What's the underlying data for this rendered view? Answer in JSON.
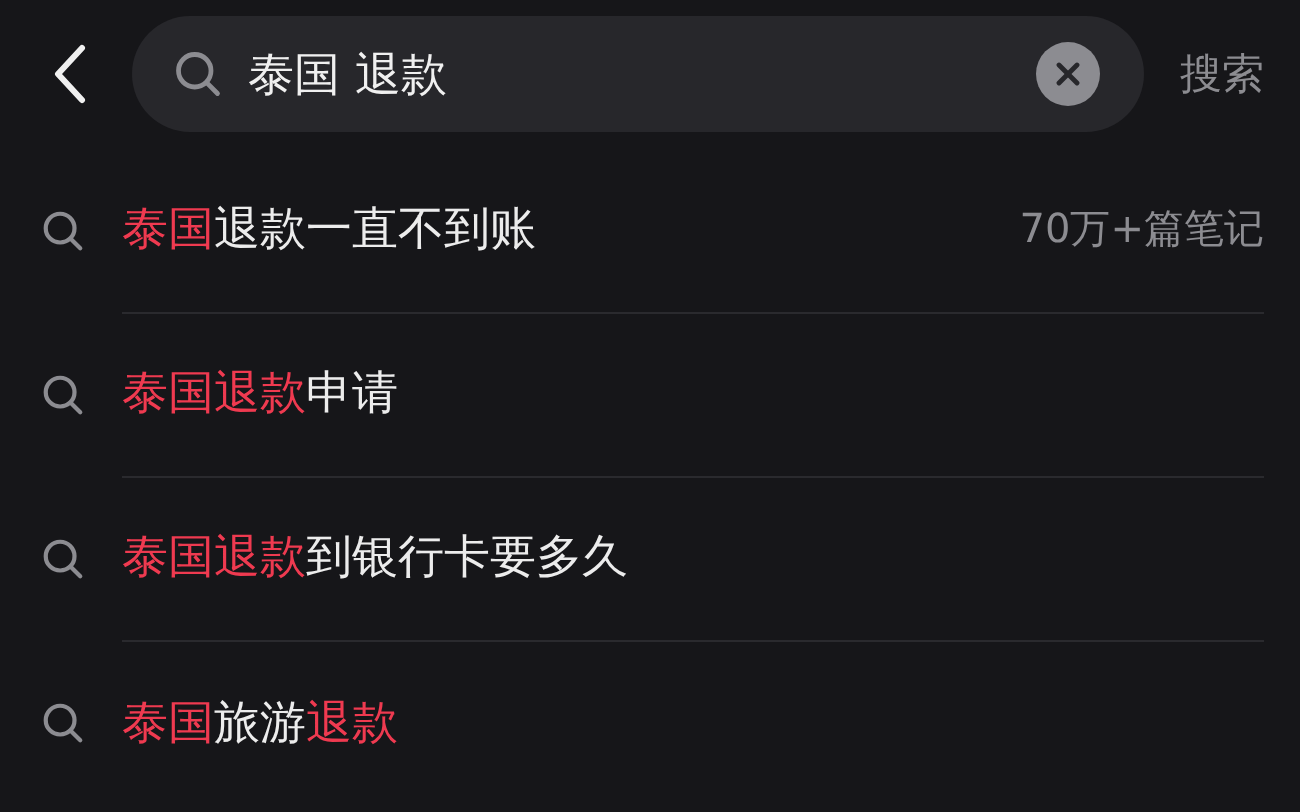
{
  "search": {
    "value": "泰国 退款",
    "submit": "搜索"
  },
  "suggestions": [
    {
      "segments": [
        {
          "text": "泰国",
          "highlight": true
        },
        {
          "text": "退款一直不到账",
          "highlight": false
        }
      ],
      "count": "70万+篇笔记"
    },
    {
      "segments": [
        {
          "text": "泰国退款",
          "highlight": true
        },
        {
          "text": "申请",
          "highlight": false
        }
      ]
    },
    {
      "segments": [
        {
          "text": "泰国退款",
          "highlight": true
        },
        {
          "text": "到银行卡要多久",
          "highlight": false
        }
      ]
    },
    {
      "segments": [
        {
          "text": "泰国",
          "highlight": true
        },
        {
          "text": "旅游",
          "highlight": false
        },
        {
          "text": "退款",
          "highlight": true
        }
      ]
    }
  ]
}
